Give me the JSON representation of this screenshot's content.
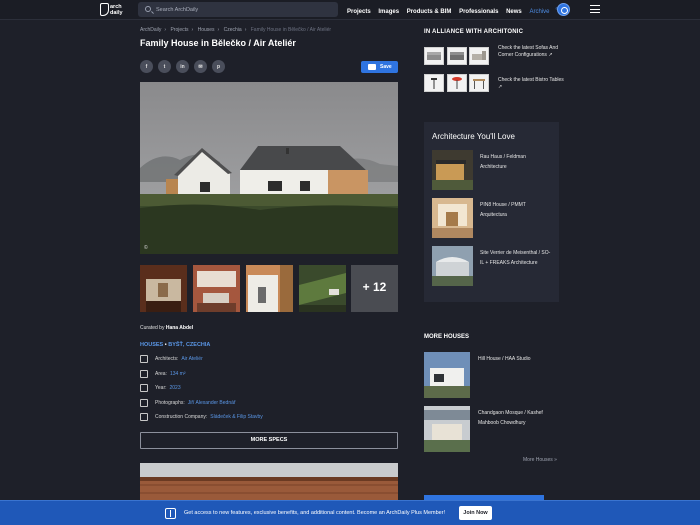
{
  "header": {
    "logo_line1": "arch",
    "logo_line2": "daily",
    "search_placeholder": "Search ArchDaily",
    "nav": [
      "Projects",
      "Images",
      "Products & BIM",
      "Professionals",
      "News"
    ],
    "archive_label": "Archive",
    "archive_superscript": "®"
  },
  "breadcrumb": [
    "ArchDaily",
    "Projects",
    "Houses",
    "Czechia",
    "Family House in Bělečko / Air Ateliér"
  ],
  "article": {
    "title": "Family House in Bělečko / Air Ateliér",
    "share_icons": [
      "facebook-icon",
      "twitter-icon",
      "linkedin-icon",
      "mail-icon",
      "pinterest-icon"
    ],
    "share_glyphs": [
      "f",
      "t",
      "in",
      "✉",
      "p"
    ],
    "save_label": "Save",
    "photo_credit_symbol": "©",
    "gallery_more": "+ 12",
    "curated_prefix": "Curated by",
    "curator": "Hana Abdel",
    "category": "HOUSES",
    "location_sep": " • ",
    "location": "BYŠŤ, CZECHIA",
    "specs": {
      "architects_label": "Architects:",
      "architects_value": "Air Ateliér",
      "area_label": "Area:",
      "area_value": "134 m²",
      "year_label": "Year:",
      "year_value": "2023",
      "photographs_label": "Photographs:",
      "photographs_value": "Jiří Alexander Bednář",
      "construction_label": "Construction Company:",
      "construction_value": "Sládeček & Filip Stavby"
    },
    "more_specs_label": "MORE SPECS"
  },
  "sidebar": {
    "alliance_title": "IN ALLIANCE WITH ARCHITONIC",
    "alliance_links": [
      {
        "text": "Check the latest Sofas And Corner Configurations",
        "ext": "↗"
      },
      {
        "text": "Check the latest Bistro Tables",
        "ext": "↗"
      }
    ],
    "love_title": "Architecture You'll Love",
    "love_items": [
      {
        "title": "Rau Haus / Feldman Architecture"
      },
      {
        "title": "PIN8 House / PMMT Arquitectura"
      },
      {
        "title": "Site Verrier de Meisenthal / SO-IL + FREAKS Architecture"
      }
    ],
    "more_houses_title": "MORE HOUSES",
    "more_houses": [
      {
        "title": "Hill House / HAA Studio"
      },
      {
        "title": "Chandgaon Mosque / Kashef Mahboob Chowdhury"
      }
    ],
    "more_houses_link": "More Houses »"
  },
  "banner": {
    "text": "Get access to new features, exclusive benefits, and additional content. Become an ArchDaily Plus Member!",
    "join_label": "Join Now"
  },
  "colors": {
    "background": "#1e2029",
    "accent_blue": "#2f74e0",
    "link_blue": "#5a96e6",
    "banner_blue": "#1f58b8"
  }
}
